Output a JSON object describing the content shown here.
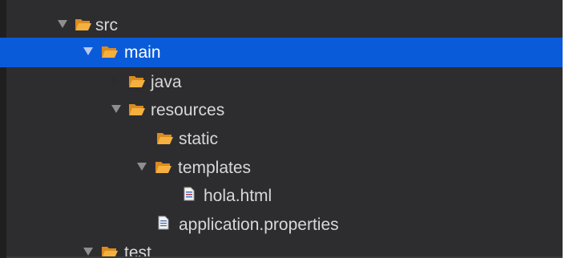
{
  "tree": {
    "items": [
      {
        "label": "src",
        "state": "expanded",
        "icon": "folder-open-icon",
        "type": "folder"
      },
      {
        "label": "main",
        "state": "expanded",
        "icon": "folder-open-icon",
        "type": "folder",
        "selected": true
      },
      {
        "label": "java",
        "state": "collapsed",
        "icon": "folder-open-icon",
        "type": "folder"
      },
      {
        "label": "resources",
        "state": "expanded",
        "icon": "folder-open-icon",
        "type": "folder"
      },
      {
        "label": "static",
        "state": "leaf",
        "icon": "folder-open-icon",
        "type": "folder"
      },
      {
        "label": "templates",
        "state": "expanded",
        "icon": "folder-open-icon",
        "type": "folder"
      },
      {
        "label": "hola.html",
        "state": "leaf",
        "icon": "html-file-icon",
        "type": "file"
      },
      {
        "label": "application.properties",
        "state": "leaf",
        "icon": "text-file-icon",
        "type": "file"
      },
      {
        "label": "test",
        "state": "expanded",
        "icon": "folder-open-icon",
        "type": "folder"
      }
    ]
  },
  "colors": {
    "panel_background": "#2d2d30",
    "selection": "#0a5bd9",
    "folder": "#f0a23a",
    "text": "#d8d8d8"
  }
}
